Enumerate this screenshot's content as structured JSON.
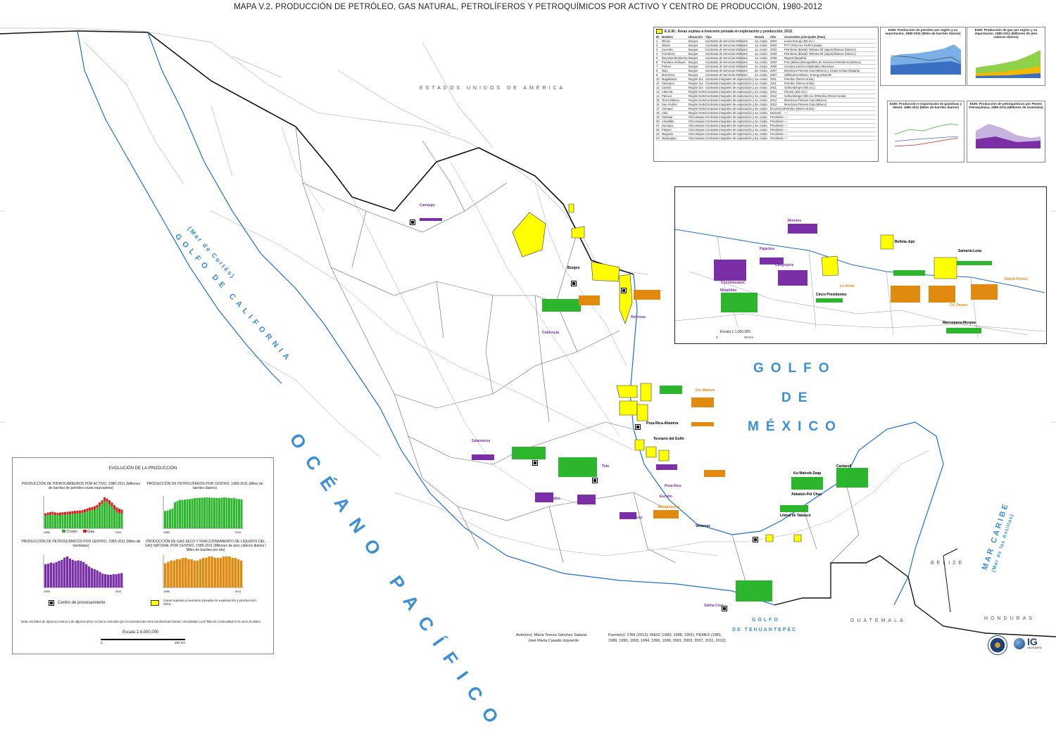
{
  "title": "MAPA V.2. PRODUCCIÓN DE PETRÓLEO, GAS NATURAL, PETROLÍFEROS Y PETROQUÍMICOS POR ACTIVO Y CENTRO DE PRODUCCIÓN, 1980-2012",
  "labels": {
    "usa": "ESTADOS UNIDOS DE AMÉRICA",
    "golfo_california": "GOLFO DE CALIFORNIA",
    "mar_cortes": "(Mar de Cortés)",
    "oceano_pacifico": "OCÉANO PACÍFICO",
    "golfo": "GOLFO",
    "de": "DE",
    "mexico": "MÉXICO",
    "mar_caribe": "MAR CARIBE",
    "mar_antillas": "(Mar de las Antillas)",
    "golfo_tehuantepec_1": "GOLFO",
    "golfo_tehuantepec_2": "DE TEHUANTEPEC",
    "belize": "BELIZE",
    "guatemala": "GUATEMALA",
    "honduras": "HONDURAS"
  },
  "places": [
    {
      "name": "Burgos",
      "color": "#000"
    },
    {
      "name": "Reynosa",
      "color": "#7b2fa6"
    },
    {
      "name": "Cadereyta",
      "color": "#7b2fa6"
    },
    {
      "name": "Camargo",
      "color": "#7b2fa6"
    },
    {
      "name": "Poza Rica-Altamira",
      "color": "#000"
    },
    {
      "name": "Cd. Madero",
      "color": "#e08a10"
    },
    {
      "name": "Tula",
      "color": "#7b2fa6"
    },
    {
      "name": "Salamanca",
      "color": "#7b2fa6"
    },
    {
      "name": "Salina Cruz",
      "color": "#7b2fa6"
    },
    {
      "name": "Cantarell",
      "color": "#000"
    },
    {
      "name": "Ku-Maloob-Zaap",
      "color": "#000"
    },
    {
      "name": "Abkatún-Pol Chuc",
      "color": "#000"
    },
    {
      "name": "Litoral de Tabasco",
      "color": "#000"
    },
    {
      "name": "Veracruz",
      "color": "#000"
    },
    {
      "name": "Terciario del Golfo",
      "color": "#000"
    },
    {
      "name": "Poza Rica",
      "color": "#7b2fa6"
    },
    {
      "name": "Escolín",
      "color": "#7b2fa6"
    },
    {
      "name": "Matapionche",
      "color": "#e08a10"
    },
    {
      "name": "Azcapotzalco",
      "color": "#7b2fa6"
    },
    {
      "name": "Texmelucan",
      "color": "#7b2fa6"
    }
  ],
  "inset_places": [
    {
      "name": "Morelos",
      "color": "#7b2fa6"
    },
    {
      "name": "Pajaritos",
      "color": "#7b2fa6"
    },
    {
      "name": "Cangrejera",
      "color": "#7b2fa6"
    },
    {
      "name": "Cosoleacaque",
      "color": "#7b2fa6"
    },
    {
      "name": "Minatitlán",
      "color": "#7b2fa6"
    },
    {
      "name": "Cinco Presidentes",
      "color": "#000"
    },
    {
      "name": "La Venta",
      "color": "#e08a10"
    },
    {
      "name": "Bellota-Jujo",
      "color": "#000"
    },
    {
      "name": "Samaria-Luna",
      "color": "#000"
    },
    {
      "name": "Cd. Pemex",
      "color": "#e08a10"
    },
    {
      "name": "Macuspana-Muspac",
      "color": "#000"
    },
    {
      "name": "Nuevo Pemex",
      "color": "#e08a10"
    }
  ],
  "inset_scale": {
    "title": "Escala 1:1,000,000",
    "left": "0",
    "right": "25 Km"
  },
  "table": {
    "title": "E.U.M.: Áreas sujetas a inversión privada en exploración y producción, 2012",
    "headers": [
      "ID",
      "Nombre",
      "Ubicación",
      "Tipo",
      "Ronda",
      "Año",
      "Asociantes principales (País)"
    ],
    "rows": [
      [
        "1",
        "Olmos",
        "Burgos",
        "Contratos de Servicios Múltiples",
        "1a. ronda",
        "2004",
        "Lewis Energy (EE.UU.)"
      ],
      [
        "2",
        "Misión",
        "Burgos",
        "Contratos de Servicios Múltiples",
        "1a. ronda",
        "2003",
        "PTT (Tetrocon Techint (Italia)"
      ],
      [
        "3",
        "Cuervito",
        "Burgos",
        "Contratos de Servicios Múltiples",
        "1a. ronda",
        "2003",
        "Petrobras (Brasil)/ Teikoku Oil (Japón)/Diavaz (México)"
      ],
      [
        "4",
        "Fronterizo",
        "Burgos",
        "Contratos de Servicios Múltiples",
        "1a. ronda",
        "2003",
        "Petrobras (Brasil)/ Teikoku Oil (Japón)/Diavaz (México)"
      ],
      [
        "5",
        "Reynosa-Monterrey",
        "Burgos",
        "Contratos de Servicios Múltiples",
        "1a. ronda",
        "2003",
        "Repsol (España)"
      ],
      [
        "6",
        "Pandura-Anáhuac",
        "Burgos",
        "Contratos de Servicios Múltiples",
        "2a. ronda",
        "2004",
        "PJC (México)/Geoprofiles de Servicios Petroleros (México)"
      ],
      [
        "7",
        "Pirineo",
        "Burgos",
        "Contratos de Servicios Múltiples",
        "2a. ronda",
        "2006",
        "Construcciones Industriales Monclova"
      ],
      [
        "8",
        "Nejo",
        "Burgos",
        "Contratos de Servicios Múltiples",
        "2a. ronda",
        "2007",
        "Monclova Pirineos Gas (México) y Grupo Colisa (España)"
      ],
      [
        "9",
        "Monclova",
        "Burgos",
        "Contratos de Servicios Múltiples",
        "2a. ronda",
        "2007",
        "Halliburton México, Energy Minerals"
      ],
      [
        "10",
        "Magallanes",
        "Región Sur",
        "Contratos integrales de exploración y producción",
        "1a. ronda",
        "2011",
        "Petrofac (Reino Unido)"
      ],
      [
        "11",
        "Santuario",
        "Región Sur",
        "Contratos integrales de exploración y producción",
        "1a. ronda",
        "2011",
        "Petrofac (Reino Unido)"
      ],
      [
        "12",
        "Carrizo",
        "Región Sur",
        "Contratos integrales de exploración y producción",
        "1a. ronda",
        "2011",
        "Schlumberger (EE.UU.)"
      ],
      [
        "13",
        "Altamira",
        "Región Norte",
        "Contratos integrales de exploración y producción",
        "2a. ronda",
        "2012",
        "Cheiron (EE.UU.)"
      ],
      [
        "14",
        "Pánuco",
        "Región Norte",
        "Contratos integrales de exploración y producción",
        "2a. ronda",
        "2012",
        "Schlumberger (EE.UU.)/Petrofac (Reino Unido)"
      ],
      [
        "15",
        "Tierra Blanca",
        "Región Norte",
        "Contratos integrales de exploración y producción",
        "2a. ronda",
        "2012",
        "Monclova Pirineos Gas (México)"
      ],
      [
        "16",
        "San Andrés",
        "Región Norte",
        "Contratos integrales de exploración y producción",
        "2a. ronda",
        "2012",
        "Monclova Pirineos Gas (México)"
      ],
      [
        "17",
        "Arenque",
        "Región Norte",
        "Contratos integrales de exploración y producción",
        "3a. ronda",
        "En proceso",
        "Petrofac (Reino Unido)"
      ],
      [
        "18",
        "Atún",
        "Región Norte",
        "Contratos integrales de exploración y producción",
        "3a. ronda",
        "Desierto",
        "---"
      ],
      [
        "19",
        "Soledad",
        "Chicontepec",
        "Contratos integrales de exploración y producción",
        "3a. ronda",
        "Pendiente",
        "---"
      ],
      [
        "20",
        "Amatitlán",
        "Chicontepec",
        "Contratos integrales de exploración y producción",
        "3a. ronda",
        "Pendiente",
        "---"
      ],
      [
        "21",
        "Humapa",
        "Chicontepec",
        "Contratos integrales de exploración y producción",
        "3a. ronda",
        "Pendiente",
        "---"
      ],
      [
        "22",
        "Pitepec",
        "Chicontepec",
        "Contratos integrales de exploración y producción",
        "3a. ronda",
        "Pendiente",
        "---"
      ],
      [
        "23",
        "Miquetla",
        "Chicontepec",
        "Contratos integrales de exploración y producción",
        "3a. ronda",
        "Pendiente",
        "---"
      ],
      [
        "24",
        "Miahuapan",
        "Chicontepec",
        "Contratos integrales de exploración y producción",
        "3a. ronda",
        "Pendiente",
        "---"
      ]
    ]
  },
  "mini_charts": {
    "oil": {
      "title": "EUM: Producción de petróleo por región y su exportación, 1980-2011 (Miles de barriles diarios)"
    },
    "gas": {
      "title": "EUM: Producción de gas por región y su importación, 1980-2011 (Millones de pies cúbicos diarios)"
    },
    "gasoline": {
      "title": "EUM: Producción e importación de gasolinas y diesel, 1980-2011 (Miles de barriles diarios)"
    },
    "petrochem": {
      "title": "EUM: Producción de petroquímicos por Pemex Petroquímica, 1980-2011 (Millones de toneladas)"
    }
  },
  "evolution": {
    "title": "EVOLUCIÓN DE LA PRODUCCIÓN",
    "c1_title": "PRODUCCIÓN DE HIDROCARBUROS POR ACTIVO, 1980-2011 (Millones de barriles de petróleo crudo equivalente)",
    "c2_title": "PRODUCCIÓN DE PETROLÍFEROS POR CENTRO, 1980-2011 (Miles de barriles diarios)",
    "c3_title": "PRODUCCIÓN DE PETROQUÍMICOS POR CENTRO, 1983-2011 (Miles de toneladas)",
    "c4_title": "PRODUCCIÓN DE GAS SECO Y FRACCIONAMIENTO DE LÍQUIDOS DEL GAS NATURAL POR CENTRO, 1985-2011 (Millones de pies cúbicos diarios / Miles de barriles por día)",
    "legend_crudo": "Crudo",
    "legend_gas": "Gas",
    "legend_centro": "Centro de procesamiento",
    "legend_areas": "Áreas sujetas a inversión privada en exploración y producción, 2012",
    "note": "Nota: los datos de algunos centros y de algunos años no fueron incluidos por inconsistencias entre las diversas fuentes consultadas o por falta de continuidad en la serie de datos.",
    "scale_title": "Escala 1:4,000,000",
    "scale_left": "0",
    "scale_right": "250 Km",
    "colors": {
      "crudo": "#2db52d",
      "gas": "#d62020",
      "petroliferos": "#2db52d",
      "petroquimicos": "#7b2fa6",
      "gas_seco": "#e08a10",
      "areas": "#ffff00"
    }
  },
  "chart_data": [
    {
      "type": "bar",
      "title": "PRODUCCIÓN DE HIDROCARBUROS POR ACTIVO, 1980-2011",
      "x": [
        "1980",
        "2011"
      ],
      "series": [
        {
          "name": "Crudo",
          "values": [
            310,
            330,
            340,
            345,
            330,
            320,
            330,
            335,
            340,
            345,
            350,
            360,
            365,
            370,
            375,
            380,
            400,
            420,
            440,
            450,
            470,
            500,
            560,
            610,
            680,
            650,
            600,
            540,
            470,
            410,
            380,
            360
          ]
        },
        {
          "name": "Gas",
          "values": [
            60,
            62,
            64,
            66,
            64,
            62,
            63,
            64,
            65,
            66,
            67,
            68,
            69,
            70,
            70,
            71,
            72,
            74,
            76,
            78,
            80,
            82,
            84,
            86,
            88,
            90,
            95,
            100,
            105,
            110,
            108,
            105
          ]
        }
      ]
    },
    {
      "type": "bar",
      "title": "PRODUCCIÓN DE PETROLÍFEROS POR CENTRO, 1980-2011",
      "x": [
        "1980",
        "2011"
      ],
      "values": [
        700,
        720,
        760,
        800,
        1050,
        1100,
        1150,
        1150,
        1160,
        1170,
        1180,
        1200,
        1220,
        1230,
        1230,
        1240,
        1240,
        1250,
        1240,
        1240,
        1230,
        1230,
        1220,
        1240,
        1250,
        1240,
        1230,
        1220,
        1230,
        1200,
        1180,
        1170
      ]
    },
    {
      "type": "bar",
      "title": "PRODUCCIÓN DE PETROQUÍMICOS POR CENTRO, 1983-2011",
      "x": [
        "1983",
        "2011"
      ],
      "values": [
        4200,
        4300,
        4500,
        4400,
        4600,
        4800,
        5000,
        5400,
        5600,
        5200,
        5000,
        4800,
        4900,
        4800,
        4600,
        4200,
        3800,
        3500,
        3300,
        3100,
        2800,
        2500,
        2400,
        2300,
        2300,
        2400,
        2400,
        2500,
        2600
      ]
    },
    {
      "type": "bar",
      "title": "PRODUCCIÓN DE GAS SECO Y FRACCIONAMIENTO DE LÍQUIDOS DEL GAS NATURAL POR CENTRO, 1985-2011",
      "x": [
        "1985",
        "2011"
      ],
      "values": [
        900,
        950,
        1000,
        1000,
        1050,
        1050,
        1100,
        1100,
        1050,
        1050,
        1000,
        1000,
        1050,
        1100,
        1100,
        1150,
        1150,
        1100,
        1100,
        1100,
        1150,
        1150,
        1150,
        1100,
        1100,
        1050,
        1000
      ]
    }
  ],
  "authors": {
    "line1": "Autor(es): María Teresa Sánchez Salazar",
    "line2": "José María Casado Izquierdo"
  },
  "sources": {
    "line1": "Fuente(s): CNH (2013); INEGI (1983, 1988, 1991); PEMEX (1981,",
    "line2": "1989, 1990, 1993, 1994, 1996, 1999, 2001, 2003, 2007, 2011, 2012)."
  },
  "logos": {
    "ig": "IG",
    "ig_sub": "GEOGRAFÍA"
  }
}
